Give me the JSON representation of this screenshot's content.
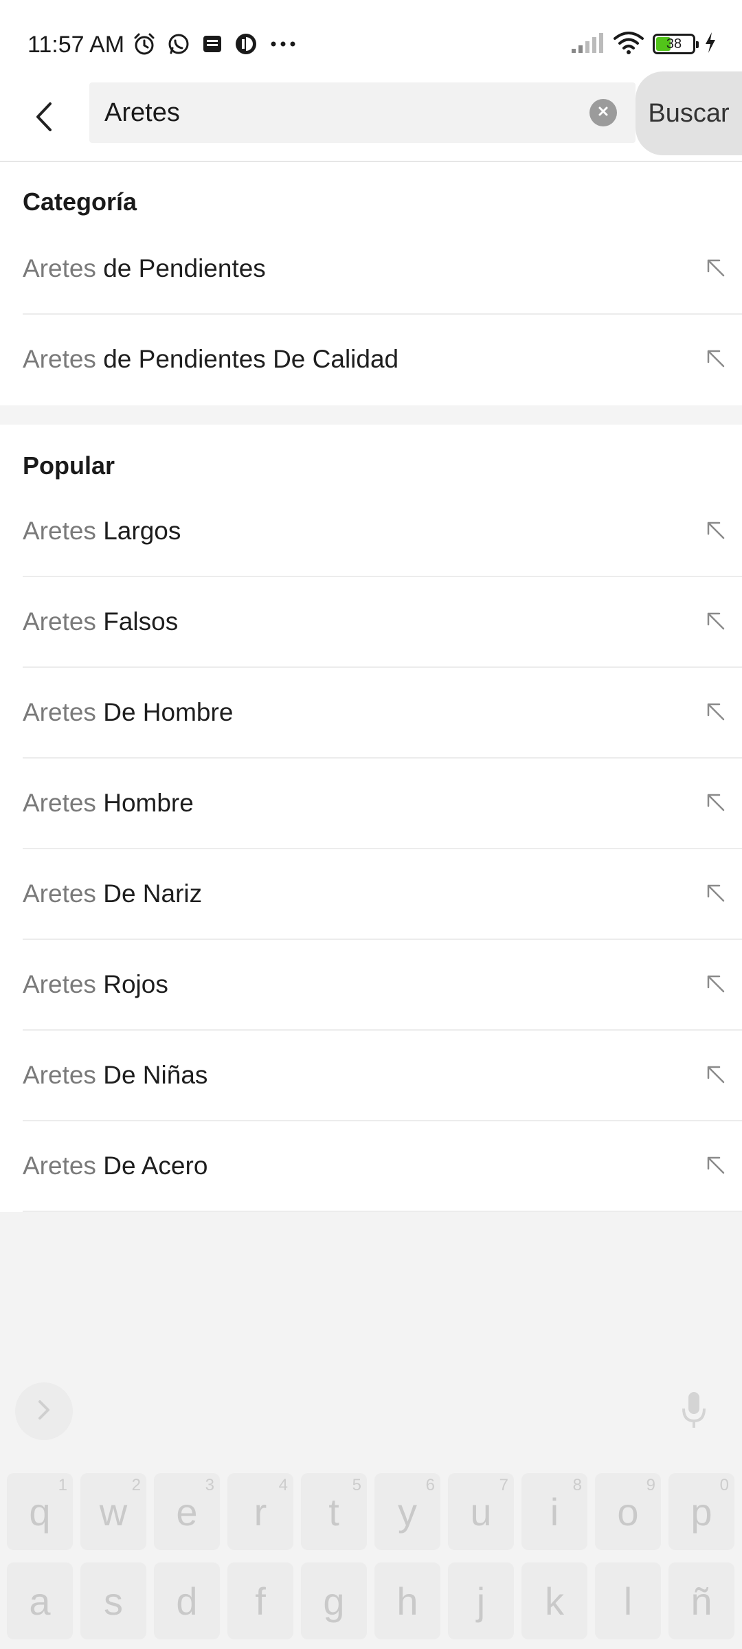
{
  "status_bar": {
    "time": "11:57 AM",
    "battery_level": "38",
    "icons": [
      "alarm-icon",
      "whatsapp-icon",
      "message-icon",
      "app-icon",
      "more-icon",
      "signal-icon",
      "wifi-icon",
      "battery-icon",
      "charging-icon"
    ]
  },
  "search": {
    "query": "Aretes",
    "submit_label": "Buscar",
    "back_icon": "back-arrow-icon",
    "clear_icon": "clear-icon"
  },
  "category_section": {
    "title": "Categoría",
    "items": [
      {
        "keyword": "Aretes",
        "suffix": " de Pendientes"
      },
      {
        "keyword": "Aretes",
        "suffix": " de Pendientes De Calidad"
      }
    ]
  },
  "popular_section": {
    "title": "Popular",
    "items": [
      {
        "keyword": "Aretes",
        "suffix": " Largos"
      },
      {
        "keyword": "Aretes",
        "suffix": " Falsos"
      },
      {
        "keyword": "Aretes",
        "suffix": " De Hombre"
      },
      {
        "keyword": "Aretes",
        "suffix": " Hombre"
      },
      {
        "keyword": "Aretes",
        "suffix": " De Nariz"
      },
      {
        "keyword": "Aretes",
        "suffix": " Rojos"
      },
      {
        "keyword": "Aretes",
        "suffix": " De Niñas"
      },
      {
        "keyword": "Aretes",
        "suffix": " De Acero"
      }
    ]
  },
  "keyboard": {
    "row1": [
      {
        "key": "q",
        "hint": "1"
      },
      {
        "key": "w",
        "hint": "2"
      },
      {
        "key": "e",
        "hint": "3"
      },
      {
        "key": "r",
        "hint": "4"
      },
      {
        "key": "t",
        "hint": "5"
      },
      {
        "key": "y",
        "hint": "6"
      },
      {
        "key": "u",
        "hint": "7"
      },
      {
        "key": "i",
        "hint": "8"
      },
      {
        "key": "o",
        "hint": "9"
      },
      {
        "key": "p",
        "hint": "0"
      }
    ],
    "row2": [
      {
        "key": "a"
      },
      {
        "key": "s"
      },
      {
        "key": "d"
      },
      {
        "key": "f"
      },
      {
        "key": "g"
      },
      {
        "key": "h"
      },
      {
        "key": "j"
      },
      {
        "key": "k"
      },
      {
        "key": "l"
      },
      {
        "key": "ñ"
      }
    ]
  },
  "colors": {
    "accent_battery": "#52c41a",
    "keyword_text": "#7a7a7a",
    "suffix_text": "#1e1e1e",
    "search_bg": "#f2f2f2",
    "submit_bg": "#e2e2e2"
  }
}
